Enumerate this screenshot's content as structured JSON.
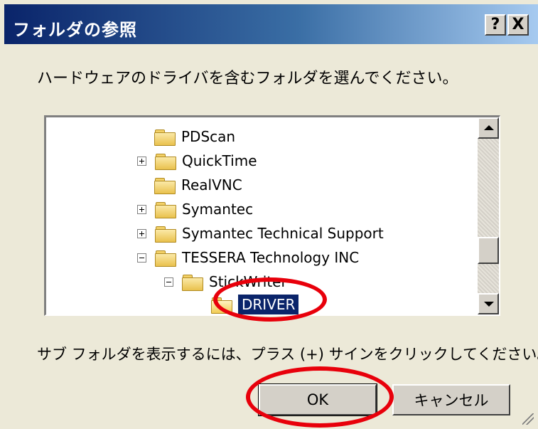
{
  "window": {
    "title": "フォルダの参照",
    "help_label": "?",
    "close_label": "X"
  },
  "instruction": "ハードウェアのドライバを含むフォルダを選んでください。",
  "tree": {
    "items": [
      {
        "label": "PDScan",
        "expander": "none"
      },
      {
        "label": "QuickTime",
        "expander": "plus"
      },
      {
        "label": "RealVNC",
        "expander": "none"
      },
      {
        "label": "Symantec",
        "expander": "plus"
      },
      {
        "label": "Symantec Technical Support",
        "expander": "plus"
      },
      {
        "label": "TESSERA Technology INC",
        "expander": "minus"
      },
      {
        "label": "StickWriter",
        "expander": "minus"
      },
      {
        "label": "DRIVER",
        "expander": "none",
        "selected": true
      }
    ]
  },
  "hint": "サブ フォルダを表示するには、プラス (+) サインをクリックしてください。",
  "buttons": {
    "ok": "OK",
    "cancel": "キャンセル"
  },
  "colors": {
    "titlebar": "#0a246a",
    "selection": "#0a246a",
    "annotation": "#e8000b",
    "face": "#ece9d8"
  }
}
